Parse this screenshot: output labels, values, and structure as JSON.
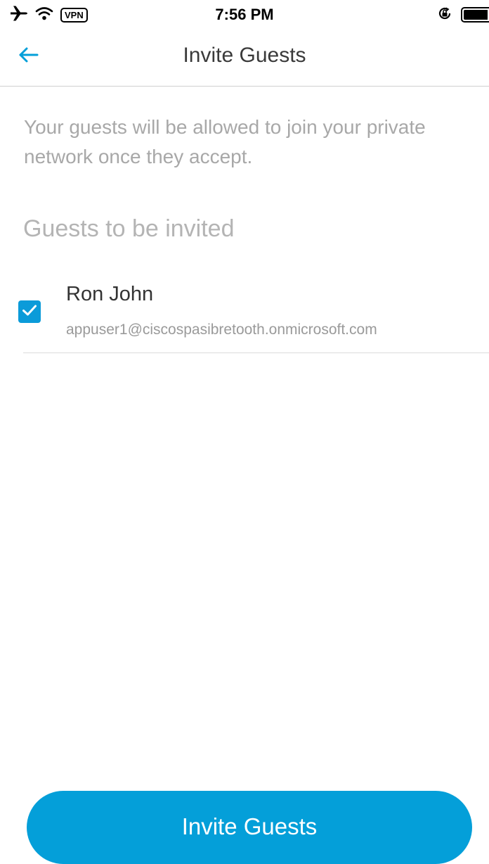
{
  "status_bar": {
    "time": "7:56 PM",
    "vpn_label": "VPN",
    "icons": [
      "airplane-icon",
      "wifi-icon",
      "vpn-badge",
      "rotation-lock-icon",
      "battery-icon"
    ]
  },
  "nav": {
    "title": "Invite Guests",
    "back_icon": "arrow-left-icon"
  },
  "description": "Your guests will be allowed to join your private network once they accept.",
  "section_header": "Guests to be invited",
  "guests": [
    {
      "name": "Ron John",
      "email": "appuser1@ciscospasibretooth.onmicrosoft.com",
      "checked": true
    }
  ],
  "invite_button_label": "Invite Guests",
  "colors": {
    "accent": "#049fd9",
    "checkbox": "#0b9bd9",
    "muted_text": "#a8a8a8"
  }
}
